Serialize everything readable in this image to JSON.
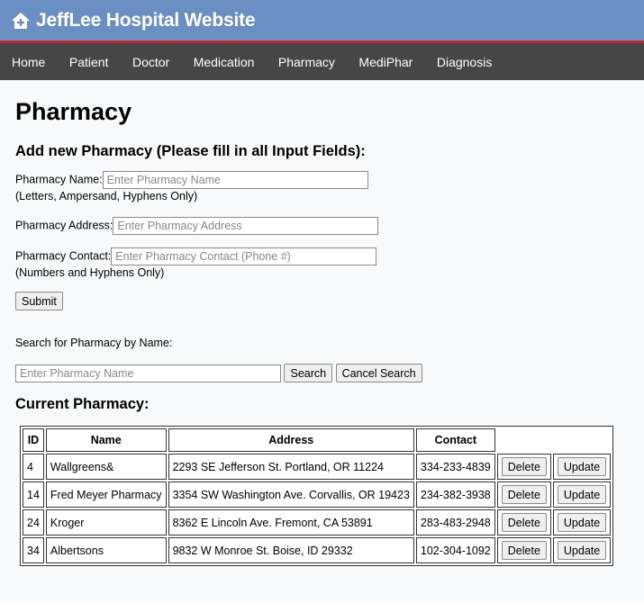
{
  "header": {
    "title": "JeffLee Hospital Website",
    "logo_icon": "hospital-home-icon"
  },
  "nav": {
    "items": [
      "Home",
      "Patient",
      "Doctor",
      "Medication",
      "Pharmacy",
      "MediPhar",
      "Diagnosis"
    ]
  },
  "page": {
    "title": "Pharmacy"
  },
  "add_form": {
    "heading": "Add new Pharmacy (Please fill in all Input Fields):",
    "name_label": "Pharmacy Name:",
    "name_placeholder": "Enter Pharmacy Name",
    "name_note": "(Letters, Ampersand, Hyphens Only)",
    "address_label": "Pharmacy Address:",
    "address_placeholder": "Enter Pharmacy Address",
    "contact_label": "Pharmacy Contact:",
    "contact_placeholder": "Enter Pharmacy Contact (Phone #)",
    "contact_note": "(Numbers and Hyphens Only)",
    "submit_label": "Submit"
  },
  "search": {
    "label": "Search for Pharmacy by Name:",
    "placeholder": "Enter Pharmacy Name",
    "search_label": "Search",
    "cancel_label": "Cancel Search"
  },
  "table": {
    "heading": "Current Pharmacy:",
    "columns": [
      "ID",
      "Name",
      "Address",
      "Contact"
    ],
    "delete_label": "Delete",
    "update_label": "Update",
    "rows": [
      {
        "id": "4",
        "name": "Wallgreens&",
        "address": "2293 SE Jefferson St. Portland, OR 11224",
        "contact": "334-233-4839"
      },
      {
        "id": "14",
        "name": "Fred Meyer Pharmacy",
        "address": "3354 SW Washington Ave. Corvallis, OR 19423",
        "contact": "234-382-3938"
      },
      {
        "id": "24",
        "name": "Kroger",
        "address": "8362 E Lincoln Ave. Fremont, CA 53891",
        "contact": "283-483-2948"
      },
      {
        "id": "34",
        "name": "Albertsons",
        "address": "9832 W Monroe St. Boise, ID 29332",
        "contact": "102-304-1092"
      }
    ]
  }
}
